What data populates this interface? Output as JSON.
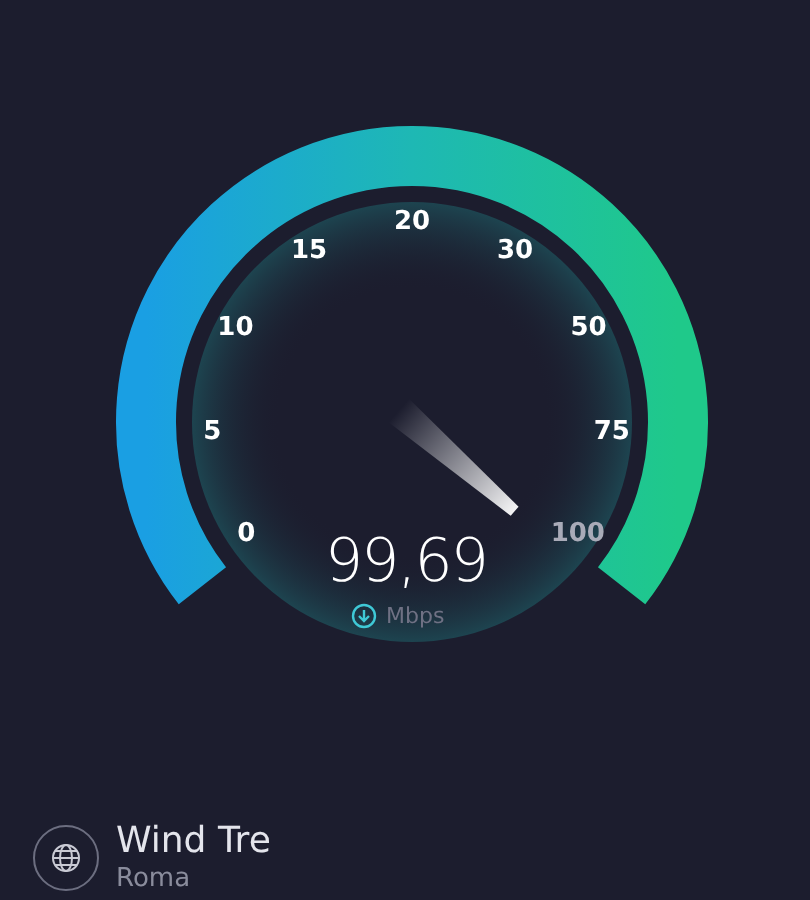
{
  "gauge": {
    "ticks": [
      "0",
      "5",
      "10",
      "15",
      "20",
      "30",
      "50",
      "75",
      "100"
    ]
  },
  "reading": {
    "value": "99,69",
    "unit": "Mbps"
  },
  "provider": {
    "name": "Wind Tre",
    "location": "Roma"
  }
}
